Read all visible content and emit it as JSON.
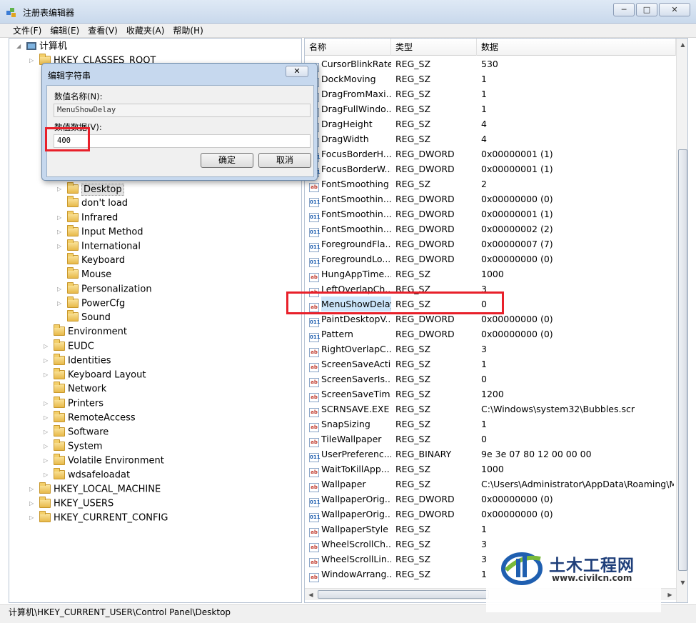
{
  "window": {
    "title": "注册表编辑器",
    "buttons": [
      "─",
      "□",
      "✕"
    ]
  },
  "menu": [
    "文件(F)",
    "编辑(E)",
    "查看(V)",
    "收藏夹(A)",
    "帮助(H)"
  ],
  "tree": {
    "root": "计算机",
    "rows": [
      {
        "label": "HKEY_CLASSES_ROOT",
        "level": 1,
        "expander": "▷"
      },
      {
        "label": "Desktop",
        "level": 3,
        "expander": "▷",
        "selected": true
      },
      {
        "label": "don't load",
        "level": 3,
        "expander": ""
      },
      {
        "label": "Infrared",
        "level": 3,
        "expander": "▷"
      },
      {
        "label": "Input Method",
        "level": 3,
        "expander": "▷"
      },
      {
        "label": "International",
        "level": 3,
        "expander": "▷"
      },
      {
        "label": "Keyboard",
        "level": 3,
        "expander": ""
      },
      {
        "label": "Mouse",
        "level": 3,
        "expander": ""
      },
      {
        "label": "Personalization",
        "level": 3,
        "expander": "▷"
      },
      {
        "label": "PowerCfg",
        "level": 3,
        "expander": "▷"
      },
      {
        "label": "Sound",
        "level": 3,
        "expander": ""
      },
      {
        "label": "Environment",
        "level": 2,
        "expander": ""
      },
      {
        "label": "EUDC",
        "level": 2,
        "expander": "▷"
      },
      {
        "label": "Identities",
        "level": 2,
        "expander": "▷"
      },
      {
        "label": "Keyboard Layout",
        "level": 2,
        "expander": "▷"
      },
      {
        "label": "Network",
        "level": 2,
        "expander": ""
      },
      {
        "label": "Printers",
        "level": 2,
        "expander": "▷"
      },
      {
        "label": "RemoteAccess",
        "level": 2,
        "expander": "▷"
      },
      {
        "label": "Software",
        "level": 2,
        "expander": "▷"
      },
      {
        "label": "System",
        "level": 2,
        "expander": "▷"
      },
      {
        "label": "Volatile Environment",
        "level": 2,
        "expander": "▷"
      },
      {
        "label": "wdsafeloadat",
        "level": 2,
        "expander": "▷"
      },
      {
        "label": "HKEY_LOCAL_MACHINE",
        "level": 1,
        "expander": "▷"
      },
      {
        "label": "HKEY_USERS",
        "level": 1,
        "expander": "▷"
      },
      {
        "label": "HKEY_CURRENT_CONFIG",
        "level": 1,
        "expander": "▷"
      }
    ]
  },
  "list": {
    "headers": {
      "name": "名称",
      "type": "类型",
      "data": "数据"
    },
    "rows": [
      {
        "name": "CursorBlinkRate",
        "type": "REG_SZ",
        "data": "530",
        "icon": "string"
      },
      {
        "name": "DockMoving",
        "type": "REG_SZ",
        "data": "1",
        "icon": "string"
      },
      {
        "name": "DragFromMaxi...",
        "type": "REG_SZ",
        "data": "1",
        "icon": "string"
      },
      {
        "name": "DragFullWindo...",
        "type": "REG_SZ",
        "data": "1",
        "icon": "string"
      },
      {
        "name": "DragHeight",
        "type": "REG_SZ",
        "data": "4",
        "icon": "string"
      },
      {
        "name": "DragWidth",
        "type": "REG_SZ",
        "data": "4",
        "icon": "string"
      },
      {
        "name": "FocusBorderH...",
        "type": "REG_DWORD",
        "data": "0x00000001 (1)",
        "icon": "binary"
      },
      {
        "name": "FocusBorderW...",
        "type": "REG_DWORD",
        "data": "0x00000001 (1)",
        "icon": "binary"
      },
      {
        "name": "FontSmoothing",
        "type": "REG_SZ",
        "data": "2",
        "icon": "string"
      },
      {
        "name": "FontSmoothin...",
        "type": "REG_DWORD",
        "data": "0x00000000 (0)",
        "icon": "binary"
      },
      {
        "name": "FontSmoothin...",
        "type": "REG_DWORD",
        "data": "0x00000001 (1)",
        "icon": "binary"
      },
      {
        "name": "FontSmoothin...",
        "type": "REG_DWORD",
        "data": "0x00000002 (2)",
        "icon": "binary"
      },
      {
        "name": "ForegroundFla...",
        "type": "REG_DWORD",
        "data": "0x00000007 (7)",
        "icon": "binary"
      },
      {
        "name": "ForegroundLo...",
        "type": "REG_DWORD",
        "data": "0x00000000 (0)",
        "icon": "binary"
      },
      {
        "name": "HungAppTime...",
        "type": "REG_SZ",
        "data": "1000",
        "icon": "string"
      },
      {
        "name": "LeftOverlapCh...",
        "type": "REG_SZ",
        "data": "3",
        "icon": "string"
      },
      {
        "name": "MenuShowDelay",
        "type": "REG_SZ",
        "data": "0",
        "icon": "string",
        "selected": true
      },
      {
        "name": "PaintDesktopV...",
        "type": "REG_DWORD",
        "data": "0x00000000 (0)",
        "icon": "binary"
      },
      {
        "name": "Pattern",
        "type": "REG_DWORD",
        "data": "0x00000000 (0)",
        "icon": "binary"
      },
      {
        "name": "RightOverlapC...",
        "type": "REG_SZ",
        "data": "3",
        "icon": "string"
      },
      {
        "name": "ScreenSaveActi...",
        "type": "REG_SZ",
        "data": "1",
        "icon": "string"
      },
      {
        "name": "ScreenSaverIs...",
        "type": "REG_SZ",
        "data": "0",
        "icon": "string"
      },
      {
        "name": "ScreenSaveTim...",
        "type": "REG_SZ",
        "data": "1200",
        "icon": "string"
      },
      {
        "name": "SCRNSAVE.EXE",
        "type": "REG_SZ",
        "data": "C:\\Windows\\system32\\Bubbles.scr",
        "icon": "string"
      },
      {
        "name": "SnapSizing",
        "type": "REG_SZ",
        "data": "1",
        "icon": "string"
      },
      {
        "name": "TileWallpaper",
        "type": "REG_SZ",
        "data": "0",
        "icon": "string"
      },
      {
        "name": "UserPreferenc...",
        "type": "REG_BINARY",
        "data": "9e 3e 07 80 12 00 00 00",
        "icon": "binary"
      },
      {
        "name": "WaitToKillApp...",
        "type": "REG_SZ",
        "data": "1000",
        "icon": "string"
      },
      {
        "name": "Wallpaper",
        "type": "REG_SZ",
        "data": "C:\\Users\\Administrator\\AppData\\Roaming\\Mi...",
        "icon": "string"
      },
      {
        "name": "WallpaperOrig...",
        "type": "REG_DWORD",
        "data": "0x00000000 (0)",
        "icon": "binary"
      },
      {
        "name": "WallpaperOrig...",
        "type": "REG_DWORD",
        "data": "0x00000000 (0)",
        "icon": "binary"
      },
      {
        "name": "WallpaperStyle",
        "type": "REG_SZ",
        "data": "1",
        "icon": "string"
      },
      {
        "name": "WheelScrollCh...",
        "type": "REG_SZ",
        "data": "3",
        "icon": "string"
      },
      {
        "name": "WheelScrollLin...",
        "type": "REG_SZ",
        "data": "3",
        "icon": "string"
      },
      {
        "name": "WindowArrang...",
        "type": "REG_SZ",
        "data": "1",
        "icon": "string"
      }
    ]
  },
  "icons": {
    "string": "ab",
    "binary": "011"
  },
  "dialog": {
    "title": "编辑字符串",
    "close": "✕",
    "name_label": "数值名称(N):",
    "name_value": "MenuShowDelay",
    "data_label": "数值数据(V):",
    "data_value": "400",
    "ok": "确定",
    "cancel": "取消"
  },
  "statusbar": "计算机\\HKEY_CURRENT_USER\\Control Panel\\Desktop",
  "watermark": {
    "text": "土木工程网",
    "url": "www.civilcn.com"
  },
  "colors": {
    "highlight": "#e8202a",
    "selection": "#cde6fb"
  }
}
